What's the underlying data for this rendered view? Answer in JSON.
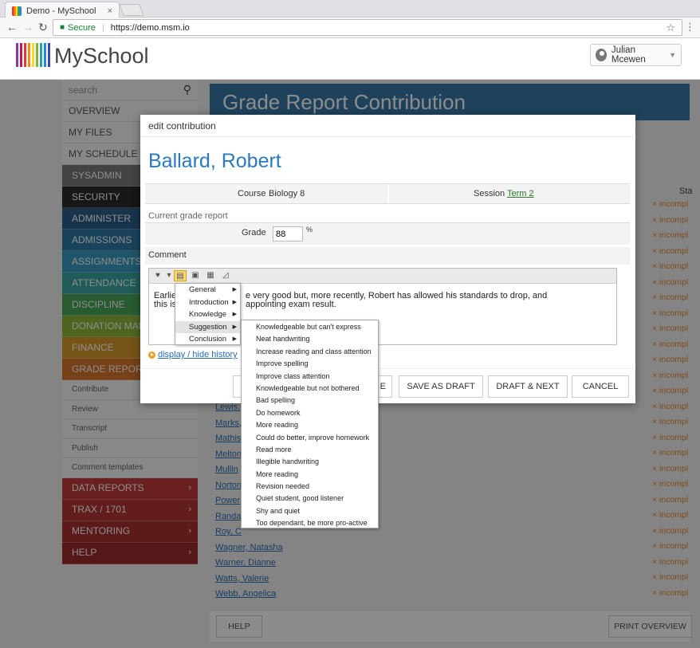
{
  "browser": {
    "tab_title": "Demo - MySchool",
    "tab_close": "×",
    "secure_label": "Secure",
    "url": "https://demo.msm.io"
  },
  "app": {
    "logo_text": "MySchool",
    "user_name": "Julian Mcewen"
  },
  "sidebar": {
    "search_placeholder": "search",
    "plain_items": [
      "OVERVIEW",
      "MY FILES",
      "MY SCHEDULE"
    ],
    "color_items": [
      {
        "label": "SYSADMIN",
        "color": "#7a7a7a"
      },
      {
        "label": "SECURITY",
        "color": "#2b2b2b"
      },
      {
        "label": "ADMINISTER",
        "color": "#2d5f8c"
      },
      {
        "label": "ADMISSIONS",
        "color": "#2f79a7"
      },
      {
        "label": "ASSIGNMENTS",
        "color": "#3a9cc1"
      },
      {
        "label": "ATTENDANCE",
        "color": "#3aa6a0"
      },
      {
        "label": "DISCIPLINE",
        "color": "#4ba65a"
      },
      {
        "label": "DONATION MAN",
        "color": "#8fb63a"
      },
      {
        "label": "FINANCE",
        "color": "#d89a2a"
      },
      {
        "label": "GRADE REPORT",
        "color": "#d9772a"
      }
    ],
    "sub_items": [
      "Contribute",
      "Review",
      "Transcript",
      "Publish",
      "Comment templates"
    ],
    "bottom_items": [
      {
        "label": "DATA REPORTS",
        "color": "#c23b3b"
      },
      {
        "label": "TRAX / 1701",
        "color": "#b53535"
      },
      {
        "label": "MENTORING",
        "color": "#a83030"
      },
      {
        "label": "HELP",
        "color": "#9c2b2b"
      }
    ]
  },
  "page": {
    "title": "Grade Report Contribution",
    "status_header": "Sta",
    "status_value": "× incompl",
    "names": [
      "Lewis,",
      "Marks,",
      "Mathis",
      "Melton",
      "Mullin",
      "Norton",
      "Power",
      "Randa",
      "Roy, C",
      "Wagner, Natasha",
      "Warner, Dianne",
      "Watts, Valerie",
      "Webb, Angelica"
    ],
    "help_button": "HELP",
    "print_button": "PRINT OVERVIEW"
  },
  "modal": {
    "header": "edit contribution",
    "student_name": "Ballard, Robert",
    "course_label": "Course",
    "course_value": "Biology 8",
    "session_label": "Session",
    "session_value": "Term 2",
    "subheading": "Current grade report",
    "grade_label": "Grade",
    "grade_value": "88",
    "grade_unit": "%",
    "comment_label": "Comment",
    "comment_line1_a": "Earlie",
    "comment_line1_b": "e very good but, more recently, Robert has allowed his standards to drop, and",
    "comment_line2_a": "this is",
    "comment_line2_b": "appointing exam result.",
    "history_link": "display / hide history",
    "buttons": {
      "save_partial": "E",
      "save_draft": "SAVE AS DRAFT",
      "draft_next": "DRAFT & NEXT",
      "cancel": "CANCEL"
    }
  },
  "context_menu": {
    "categories": [
      "General",
      "Introduction",
      "Knowledge",
      "Suggestion",
      "Conclusion"
    ],
    "active_category": "Suggestion",
    "suggestions": [
      "Knowledgeable but can't express",
      "Neat handwriting",
      "Increase reading and class attention",
      "Improve spelling",
      "Improve class attention",
      "Knowledgeable but not bothered",
      "Bad spelling",
      "Do homework",
      "More reading",
      "Could do better, improve homework",
      "Read more",
      "Illegible handwriting",
      "More reading",
      "Revision needed",
      "Quiet student, good listener",
      "Shy and quiet",
      "Too dependant, be more pro-active"
    ]
  },
  "colors": {
    "title_bar": "#3a78a8",
    "link_blue": "#2a6fb5",
    "status_orange": "#e88a2e"
  }
}
